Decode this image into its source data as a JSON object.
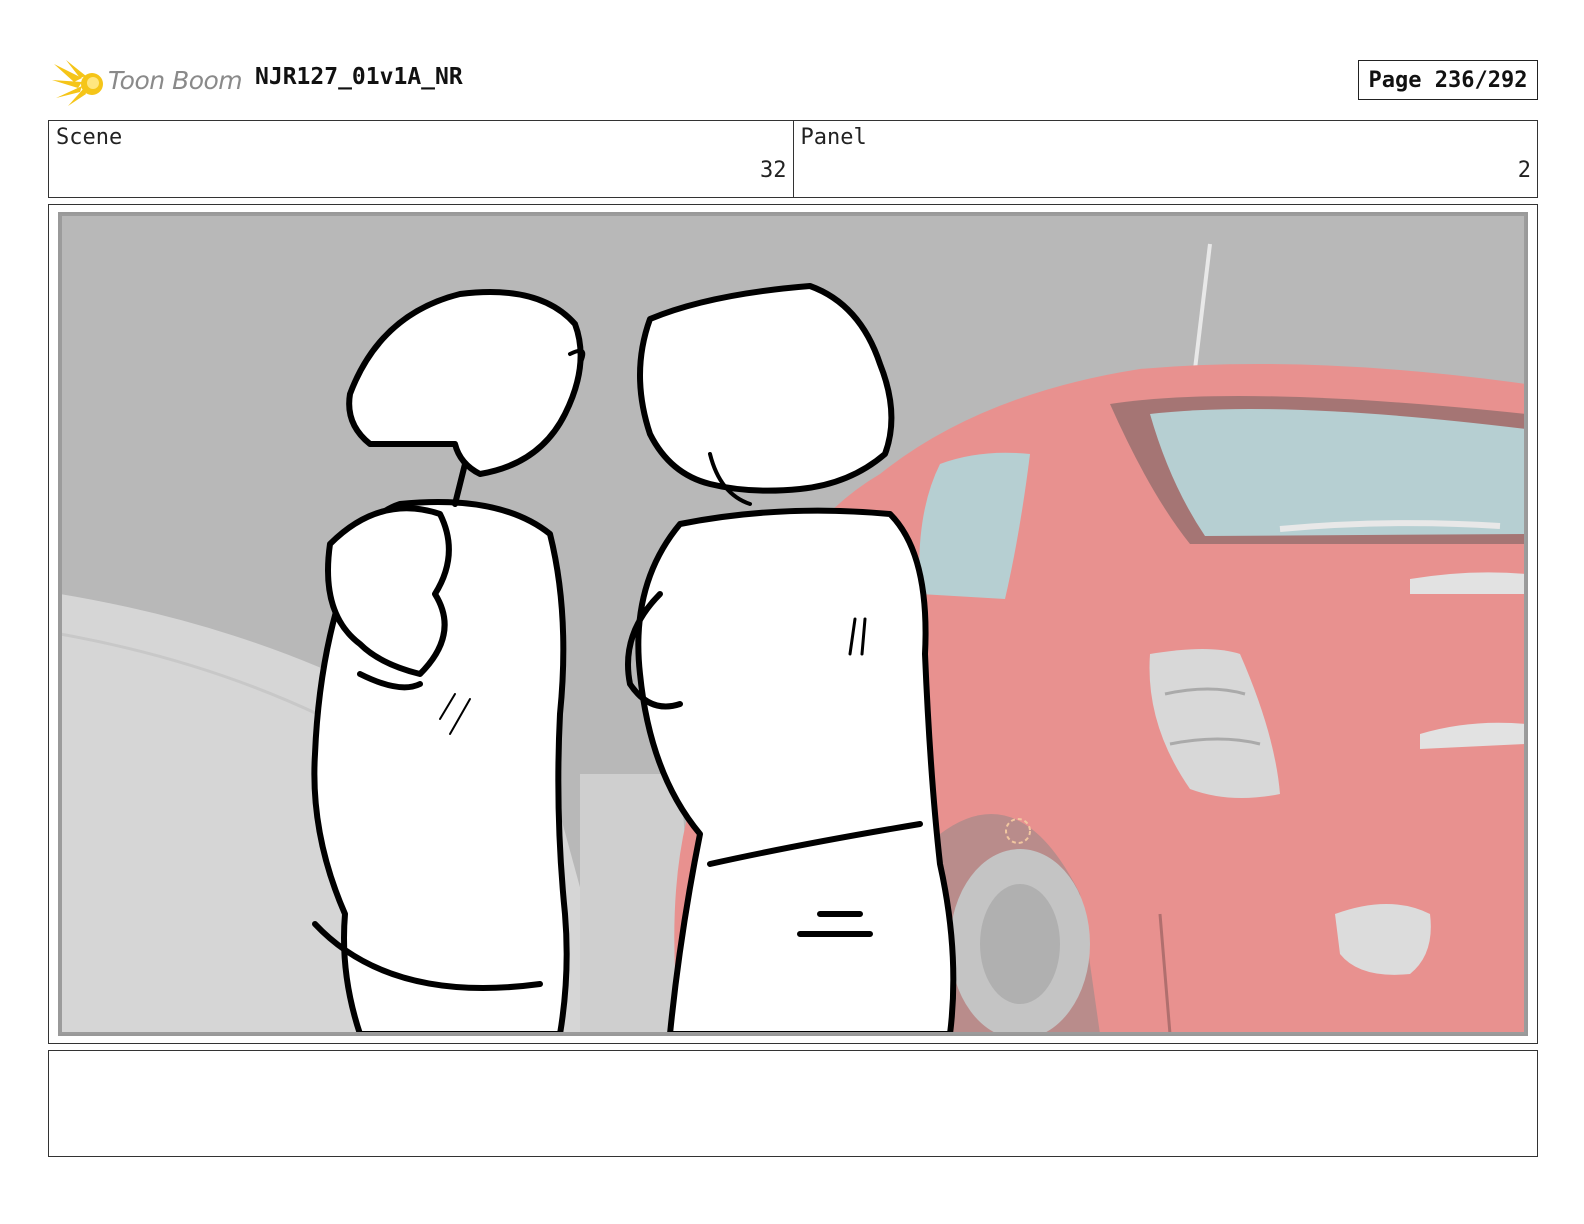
{
  "header": {
    "logo_text": "Toon Boom",
    "logo_icon": "sunburst-logo-icon",
    "title": "NJR127_01v1A_NR",
    "page_label": "Page 236/292"
  },
  "info": {
    "scene_label": "Scene",
    "scene_value": "32",
    "panel_label": "Panel",
    "panel_value": "2"
  },
  "panel": {
    "description": "",
    "colors": {
      "background": "#b8b8b8",
      "car_body": "#e8918f",
      "car_window": "#b6cfd2",
      "logo_yellow": "#f5c518"
    }
  },
  "caption": {
    "text": ""
  }
}
